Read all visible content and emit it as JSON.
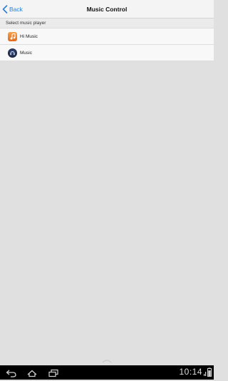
{
  "header": {
    "back_label": "Back",
    "title": "Music Control"
  },
  "section": {
    "label": "Select music player"
  },
  "players": [
    {
      "label": "Hi Music",
      "icon": "hi-music-icon"
    },
    {
      "label": "Music",
      "icon": "music-icon"
    }
  ],
  "system_bar": {
    "time": "10:14",
    "battery_percent": 78
  },
  "colors": {
    "accent": "#2b7fd6",
    "background": "#e0e0e0"
  }
}
